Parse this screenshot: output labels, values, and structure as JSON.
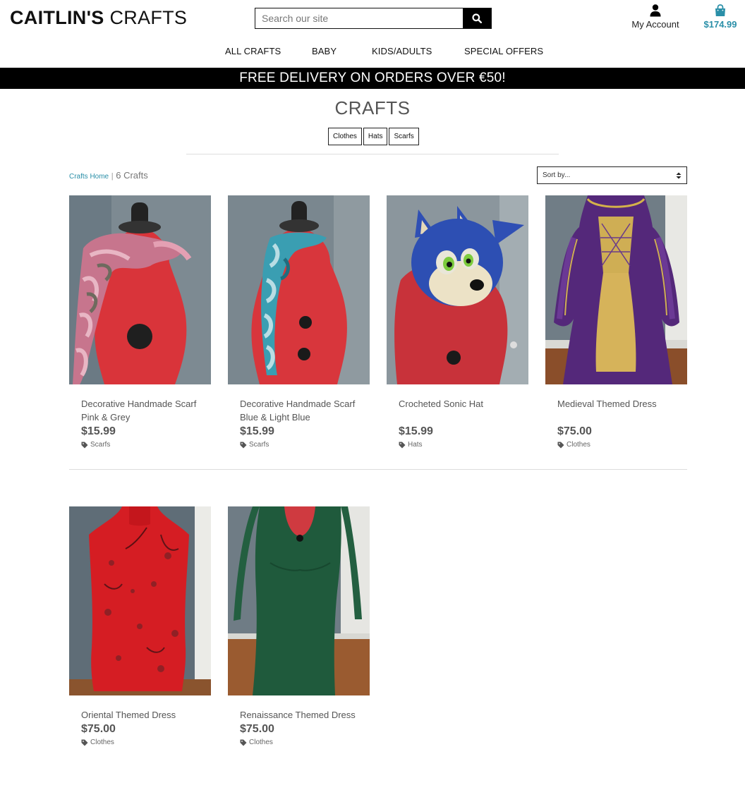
{
  "header": {
    "logo_bold": "CAITLIN'S",
    "logo_thin": "CRAFTS",
    "search_placeholder": "Search our site",
    "account_label": "My Account",
    "bag_total": "$174.99"
  },
  "nav": {
    "items": [
      {
        "label": "ALL CRAFTS"
      },
      {
        "label": "BABY"
      },
      {
        "label": "KIDS/ADULTS"
      },
      {
        "label": "SPECIAL OFFERS"
      }
    ]
  },
  "banner": {
    "text": "FREE DELIVERY ON ORDERS OVER €50!"
  },
  "page": {
    "title": "CRAFTS",
    "filters": [
      "Clothes",
      "Hats",
      "Scarfs"
    ],
    "breadcrumb_link": "Crafts Home",
    "breadcrumb_sep": "|",
    "count_text": "6 Crafts",
    "sort_label": "Sort by..."
  },
  "products": [
    {
      "name": "Decorative Handmade Scarf Pink & Grey",
      "price": "$15.99",
      "category": "Scarfs"
    },
    {
      "name": "Decorative Handmade Scarf Blue & Light Blue",
      "price": "$15.99",
      "category": "Scarfs"
    },
    {
      "name": "Crocheted Sonic Hat",
      "price": "$15.99",
      "category": "Hats"
    },
    {
      "name": "Medieval Themed Dress",
      "price": "$75.00",
      "category": "Clothes"
    },
    {
      "name": "Oriental Themed Dress",
      "price": "$75.00",
      "category": "Clothes"
    },
    {
      "name": "Renaissance Themed Dress",
      "price": "$75.00",
      "category": "Clothes"
    }
  ],
  "colors": {
    "accent": "#2a8fa8",
    "banner_bg": "#000000",
    "text": "#555555"
  },
  "icons": {
    "search": "search-icon",
    "account": "user-icon",
    "bag": "shopping-bag-icon",
    "tag": "tag-icon",
    "sort": "sort-arrows-icon"
  }
}
